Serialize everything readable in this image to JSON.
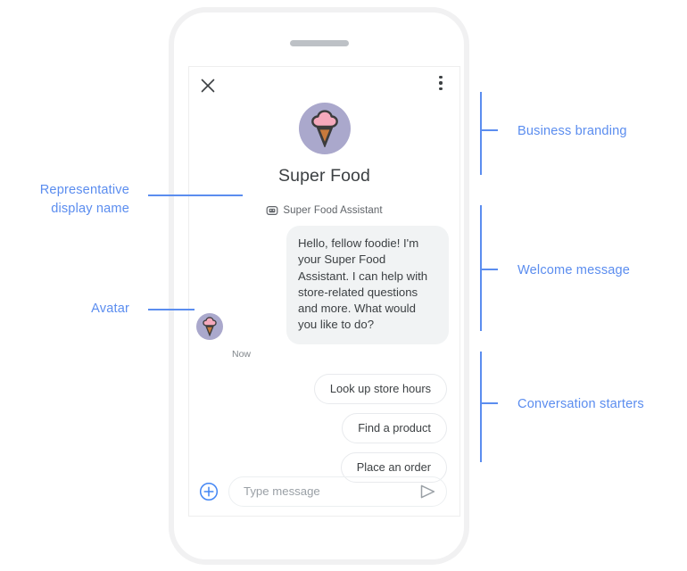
{
  "colors": {
    "annotation_blue": "#5b8def",
    "logo_circle": "#aaa8cc",
    "logo_scoop_pink": "#f5a9bc",
    "logo_cone_orange": "#c87a3c",
    "logo_outline": "#3c3c3c",
    "bubble_bg": "#f1f3f4",
    "text_primary": "#3c4043",
    "text_secondary": "#5f6368",
    "plus_blue": "#4285f4",
    "send_gray": "#9aa0a6",
    "phone_frame": "#f1f1f2"
  },
  "phone": {
    "speaker_name": "speaker-grille"
  },
  "chat": {
    "topbar": {
      "close_icon": "close-icon",
      "menu_icon": "more-vert-icon"
    },
    "branding": {
      "logo_icon": "ice-cream-logo-icon",
      "business_name": "Super Food"
    },
    "representative": {
      "badge_icon": "robot-assistant-icon",
      "display_name": "Super Food Assistant"
    },
    "message": {
      "avatar_icon": "ice-cream-avatar-icon",
      "text": "Hello, fellow foodie! I'm your Super Food Assistant. I can help with store-related questions and more. What would you like to do?",
      "timestamp": "Now"
    },
    "starters": [
      {
        "label": "Look up store hours"
      },
      {
        "label": "Find a product"
      },
      {
        "label": "Place an order"
      }
    ],
    "composer": {
      "plus_icon": "add-circle-icon",
      "input_value": "",
      "input_placeholder": "Type message",
      "send_icon": "send-icon"
    }
  },
  "annotations": {
    "business_branding": "Business branding",
    "welcome_message": "Welcome message",
    "conversation_starters": "Conversation starters",
    "representative_display_name": "Representative\ndisplay name",
    "avatar": "Avatar"
  }
}
